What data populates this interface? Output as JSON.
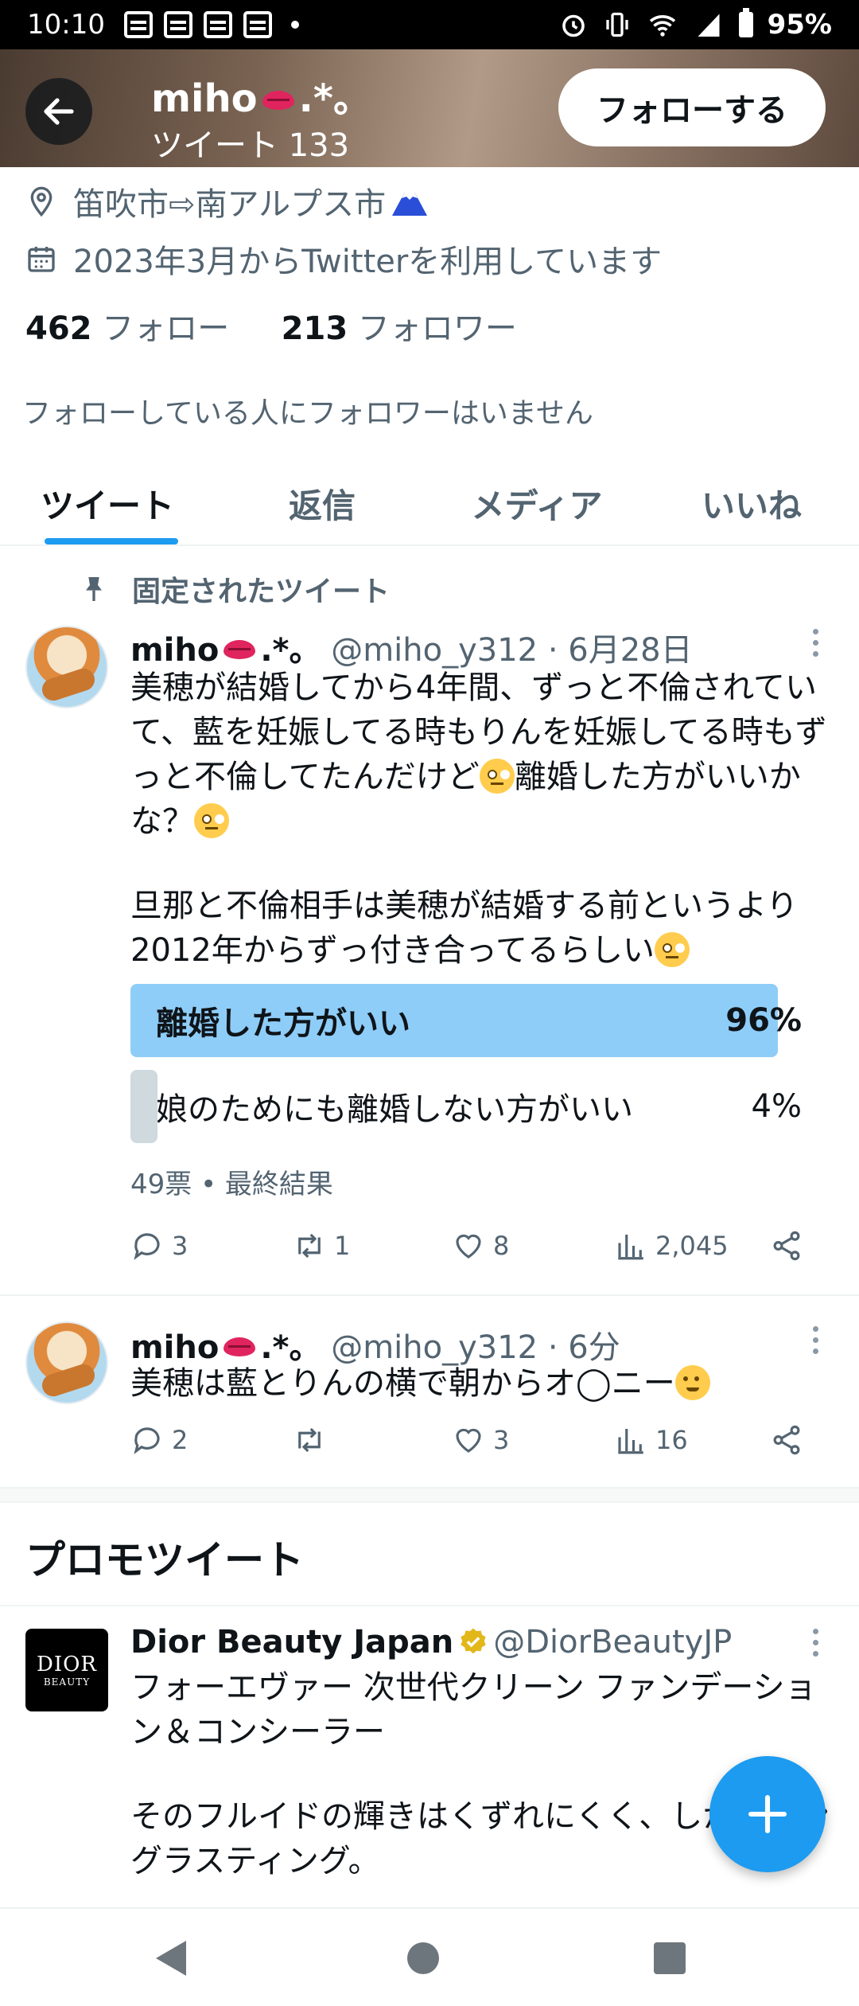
{
  "status_bar": {
    "time": "10:10",
    "battery": "95%"
  },
  "header": {
    "name": "miho",
    "name_suffix": ".*。",
    "tweet_count": "ツイート 133",
    "follow_label": "フォローする"
  },
  "profile": {
    "location": "笛吹市⇨南アルプス市",
    "joined": "2023年3月からTwitterを利用しています",
    "following_count": "462",
    "following_label": "フォロー",
    "followers_count": "213",
    "followers_label": "フォロワー",
    "no_mutual_followers": "フォローしている人にフォロワーはいません"
  },
  "tabs": [
    {
      "label": "ツイート",
      "active": true
    },
    {
      "label": "返信",
      "active": false
    },
    {
      "label": "メディア",
      "active": false
    },
    {
      "label": "いいね",
      "active": false
    }
  ],
  "pinned_label": "固定されたツイート",
  "tweet1": {
    "name": "miho",
    "name_suffix": ".*。",
    "handle_time": "@miho_y312 · 6月28日",
    "text_a": "美穂が結婚してから4年間、ずっと不倫されていて、藍を妊娠してる時もりんを妊娠してる時もずっと不倫してたんだけど",
    "text_b": "離婚した方がいいかな？",
    "text_c": "旦那と不倫相手は美穂が結婚する前というより2012年からずっ付き合ってるらしい",
    "poll": [
      {
        "label": "離婚した方がいい",
        "percent_text": "96%",
        "value": 96,
        "winner": true
      },
      {
        "label": "娘のためにも離婚しない方がいい",
        "percent_text": "4%",
        "value": 4,
        "winner": false
      }
    ],
    "poll_meta": "49票 • 最終結果",
    "replies": "3",
    "retweets": "1",
    "likes": "8",
    "views": "2,045"
  },
  "tweet2": {
    "name": "miho",
    "name_suffix": ".*。",
    "handle_time": "@miho_y312 · 6分",
    "text": "美穂は藍とりんの横で朝からオ◯ニー",
    "replies": "2",
    "retweets": "",
    "likes": "3",
    "views": "16"
  },
  "promo": {
    "section_title": "プロモツイート",
    "logo_line1": "DIOR",
    "logo_line2": "BEAUTY",
    "name": "Dior Beauty Japan",
    "handle": "@DiorBeautyJP",
    "text_a": "フォーエヴァー 次世代クリーン ファンデーション＆コンシーラー",
    "text_b": "そのフルイドの輝きはくずれにくく、しかもロングラスティング。"
  },
  "colors": {
    "accent": "#1d9bf0",
    "poll_winner": "#8ecdf8",
    "poll_other": "#cfd9de"
  }
}
